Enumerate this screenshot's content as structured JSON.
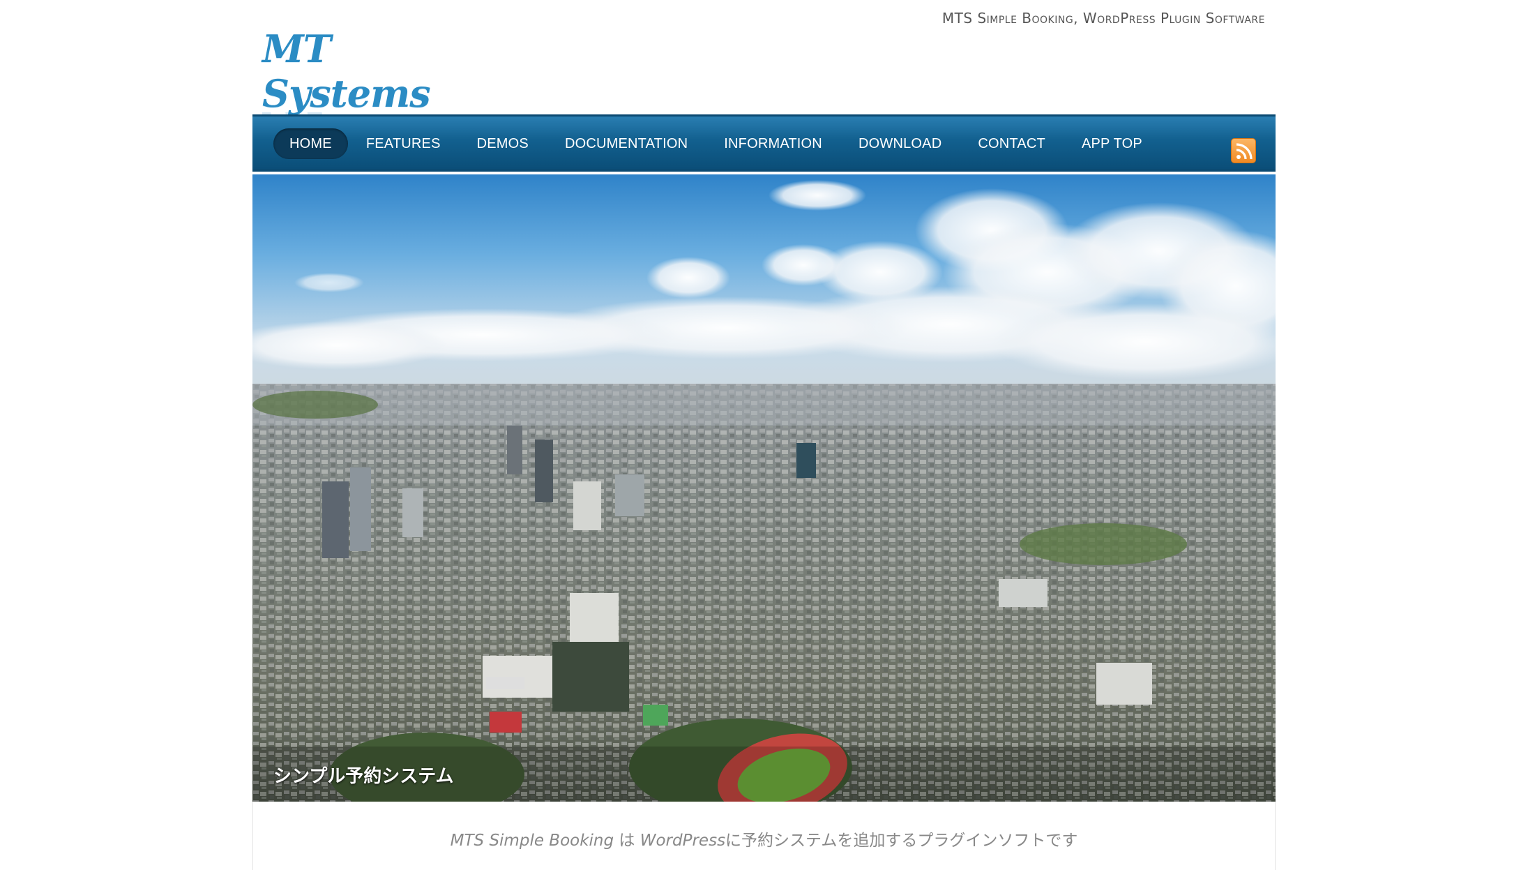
{
  "header": {
    "tagline": "MTS Simple Booking, WordPress Plugin Software",
    "logo_text": "MT Systems"
  },
  "nav": {
    "items": [
      {
        "label": "HOME",
        "active": true
      },
      {
        "label": "FEATURES"
      },
      {
        "label": "DEMOS"
      },
      {
        "label": "DOCUMENTATION"
      },
      {
        "label": "INFORMATION"
      },
      {
        "label": "DOWNLOAD"
      },
      {
        "label": "CONTACT"
      },
      {
        "label": "APP TOP"
      }
    ],
    "rss_icon": "rss-icon"
  },
  "hero": {
    "caption": "シンプル予約システム"
  },
  "content": {
    "intro_part1": "MTS Simple Booking",
    "intro_part2": " は ",
    "intro_part3": "WordPress",
    "intro_part4": "に予約システムを追加するプラグインソフトです"
  },
  "colors": {
    "nav_bg": "#12608f",
    "nav_active": "#0c3a59",
    "logo": "#2b8cc4",
    "rss": "#f08a24"
  }
}
